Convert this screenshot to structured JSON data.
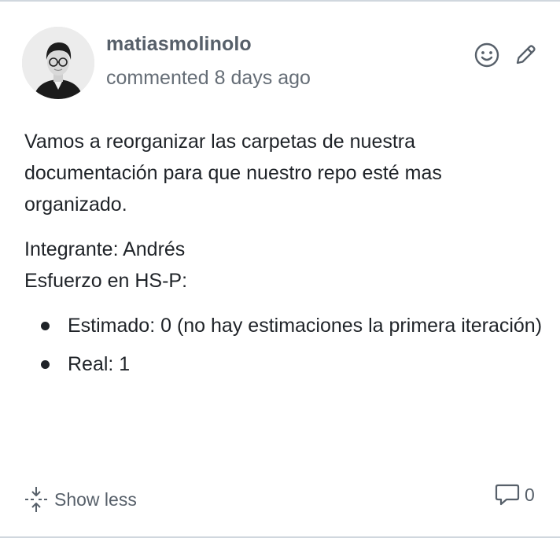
{
  "comment": {
    "author": "matiasmolinolo",
    "action": "commented",
    "time_ago": "8 days ago",
    "paragraph1": "Vamos a reorganizar las carpetas de nuestra documentación para que nuestro repo esté mas organizado.",
    "member_line": "Integrante: Andrés",
    "effort_line": "Esfuerzo en HS-P:",
    "list_items": [
      "Estimado: 0 (no hay estimaciones la primera iteración)",
      "Real: 1"
    ]
  },
  "actions": {
    "reaction_icon": "smiley-icon",
    "edit_icon": "pencil-icon"
  },
  "footer": {
    "show_less_label": "Show less",
    "show_less_icon": "fold-icon",
    "comment_icon": "comment-icon",
    "comment_count": "0"
  },
  "colors": {
    "text": "#1f2328",
    "muted": "#57606a",
    "border": "#d0d7de"
  }
}
